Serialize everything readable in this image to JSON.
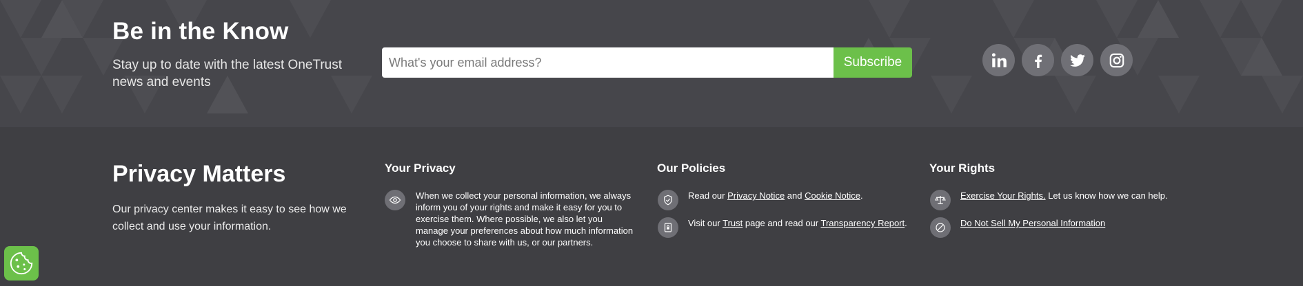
{
  "newsletter": {
    "title": "Be in the Know",
    "subtitle": "Stay up to date with the latest OneTrust news and events",
    "email_placeholder": "What's your email address?",
    "subscribe_label": "Subscribe"
  },
  "social": [
    {
      "icon": "linkedin-icon"
    },
    {
      "icon": "facebook-icon"
    },
    {
      "icon": "twitter-icon"
    },
    {
      "icon": "instagram-icon"
    }
  ],
  "privacy": {
    "title": "Privacy Matters",
    "description": "Our privacy center makes it easy to see how we collect and use your information."
  },
  "your_privacy": {
    "title": "Your Privacy",
    "text": "When we collect your personal information, we always inform you of your rights and make it easy for you to exercise them. Where possible, we also let you manage your preferences about how much information you choose to share with us, or our partners."
  },
  "our_policies": {
    "title": "Our Policies",
    "line1_prefix": "Read our ",
    "privacy_notice": "Privacy Notice",
    "line1_and": " and ",
    "cookie_notice": "Cookie Notice",
    "line1_suffix": ".",
    "line2_prefix": "Visit our ",
    "trust": "Trust",
    "line2_mid": " page and read our ",
    "transparency_report": "Transparency Report",
    "line2_suffix": "."
  },
  "your_rights": {
    "title": "Your Rights",
    "exercise_link": "Exercise Your Rights.",
    "exercise_suffix": " Let us know how we can help.",
    "do_not_sell": "Do Not Sell My Personal Information"
  },
  "colors": {
    "accent_green": "#6cc04a",
    "background": "#3f3f43",
    "icon_circle": "#707076"
  }
}
